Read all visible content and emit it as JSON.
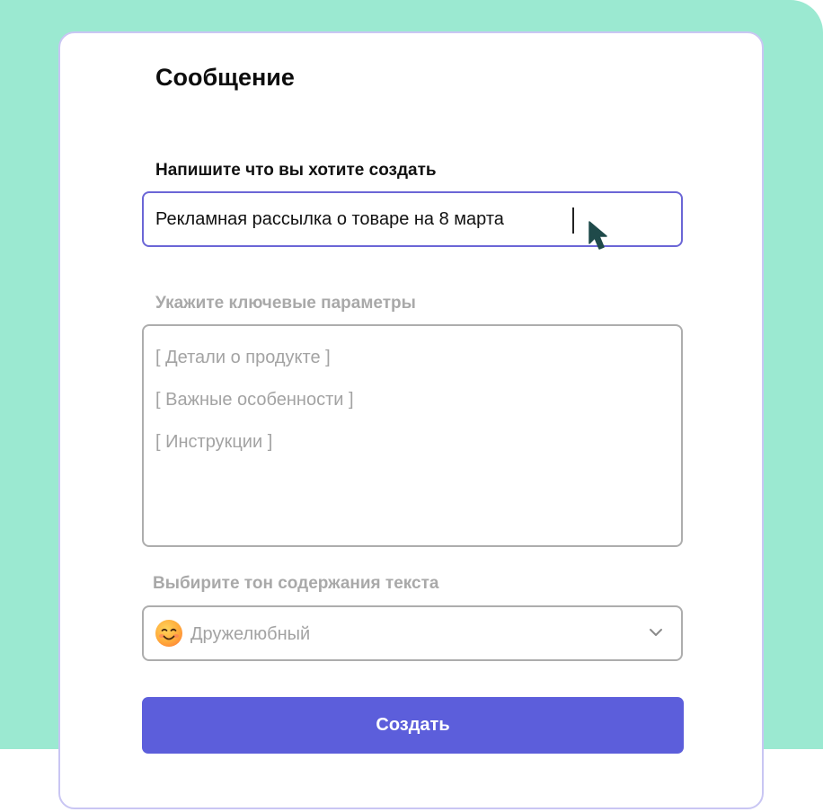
{
  "form": {
    "title": "Сообщение",
    "prompt_label": "Напишите что вы хотите создать",
    "prompt_value": "Рекламная рассылка о товаре на 8 марта",
    "params_label": "Укажите ключевые параметры",
    "params_placeholders": [
      "[ Детали о продукте ]",
      "[ Важные особенности ]",
      "[ Инструкции ]"
    ],
    "tone_label": "Выбирите тон содержания текста",
    "tone_value": "Дружелюбный",
    "tone_icon": "smiling-face-emoji-icon",
    "submit_label": "Создать"
  },
  "colors": {
    "background": "#9be9d1",
    "accent": "#5c5edb",
    "active_border": "#6b66d6",
    "card_border": "#c9c6f3",
    "muted_text": "#a9a9a9"
  }
}
